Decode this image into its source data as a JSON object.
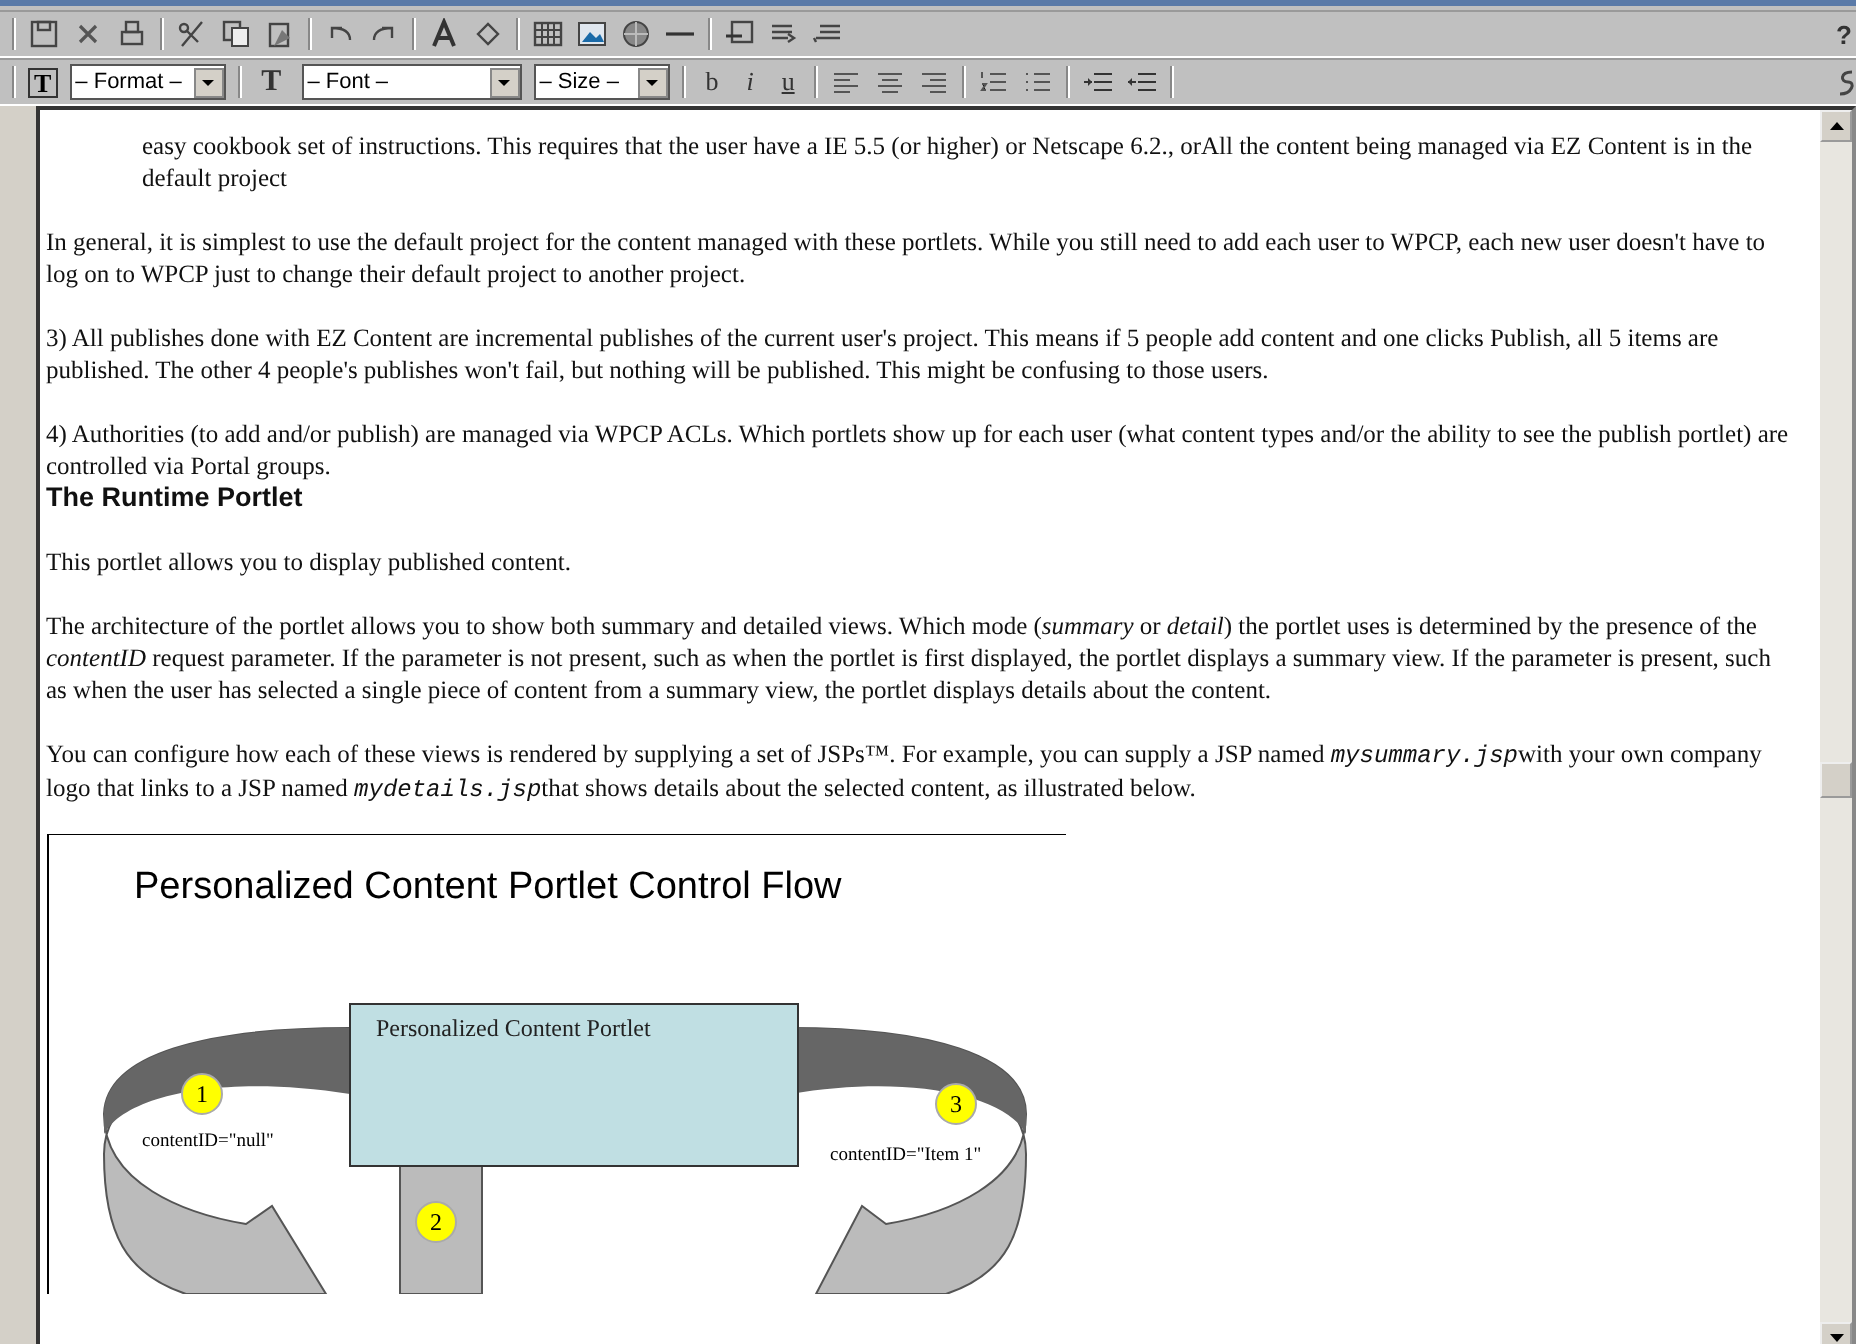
{
  "toolbar": {
    "help": "?",
    "format_select": "– Format –",
    "font_select": "– Font –",
    "size_select": "– Size –",
    "text_style_glyph": "T",
    "font_glyph": "T",
    "bold": "b",
    "italic": "i",
    "underline": "u"
  },
  "document": {
    "paragraphs": [
      {
        "kind": "indented",
        "text": "easy cookbook set of instructions. This requires that the user have a IE 5.5 (or higher) or Netscape 6.2., orAll the content being managed via EZ Content is in the default project"
      },
      {
        "kind": "para",
        "text": "In general, it is simplest to use the default project for the content managed with these portlets. While you still need to add each user to WPCP, each new user doesn't have to log on to WPCP just to change their default project to another project."
      },
      {
        "kind": "para",
        "text": "3) All publishes done with EZ Content are incremental publishes of the current user's project. This means if 5 people add content and one clicks Publish, all 5 items are published. The other 4 people's publishes won't fail, but nothing will be published. This might be confusing to those users."
      },
      {
        "kind": "para_tight",
        "text": "4) Authorities (to add and/or publish) are managed via WPCP ACLs. Which portlets show up for each user (what content types and/or the ability to see the publish portlet) are controlled via Portal groups."
      },
      {
        "kind": "heading",
        "text": "The Runtime Portlet"
      },
      {
        "kind": "para",
        "text": "This portlet allows you to display published content."
      },
      {
        "kind": "para",
        "runs": [
          {
            "kind": "plain",
            "text": "The architecture of the portlet allows you to show both summary and detailed views.  Which mode ("
          },
          {
            "kind": "italic",
            "text": "summary"
          },
          {
            "kind": "plain",
            "text": " or "
          },
          {
            "kind": "italic",
            "text": "detail"
          },
          {
            "kind": "plain",
            "text": ") the portlet uses is determined by the presence of the "
          },
          {
            "kind": "italic",
            "text": "contentID"
          },
          {
            "kind": "plain",
            "text": " request parameter.  If the parameter is not present, such as when the portlet is first displayed, the portlet displays a summary view. If the parameter is present, such as when the user has selected a single piece of content from a summary view, the portlet displays details about the content."
          }
        ]
      },
      {
        "kind": "para",
        "runs": [
          {
            "kind": "plain",
            "text": "You can configure how each of these views is rendered by supplying a set of JSPs™.  For example, you can supply a JSP named "
          },
          {
            "kind": "code",
            "text": "mysummary.jsp"
          },
          {
            "kind": "plain",
            "text": "with your own company logo that links to a JSP named "
          },
          {
            "kind": "code",
            "text": "mydetails.jsp"
          },
          {
            "kind": "plain",
            "text": "that shows details about the selected content, as illustrated below."
          }
        ]
      }
    ],
    "diagram": {
      "title": "Personalized Content Portlet Control Flow",
      "box_label": "Personalized Content Portlet",
      "left_label": "contentID=\"null\"",
      "right_label": "contentID=\"Item 1\"",
      "steps": [
        "1",
        "2",
        "3"
      ]
    }
  }
}
